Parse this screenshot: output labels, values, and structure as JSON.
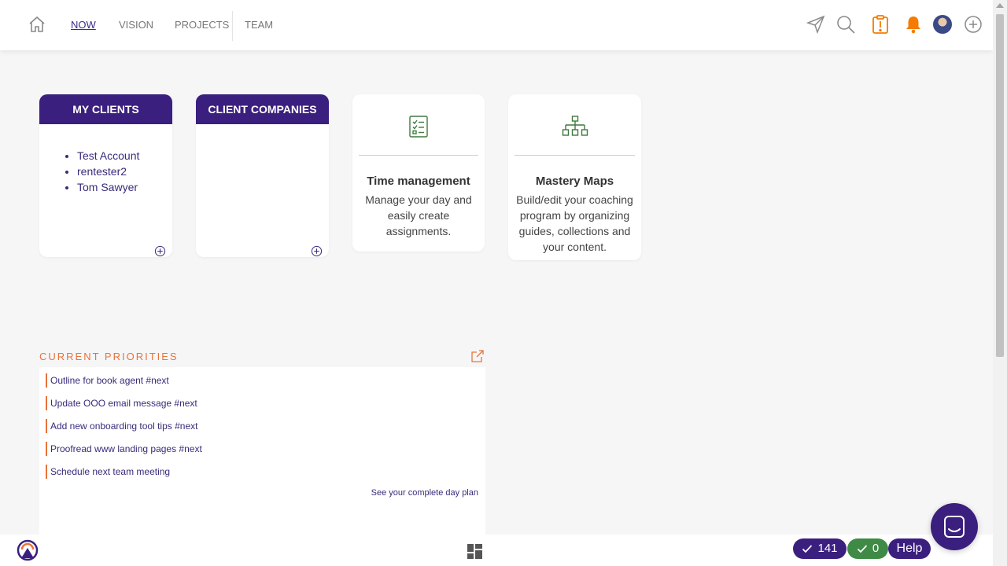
{
  "nav": {
    "tabs": [
      {
        "label": "NOW",
        "active": true
      },
      {
        "label": "VISION",
        "active": false
      },
      {
        "label": "PROJECTS",
        "active": false
      },
      {
        "label": "TEAM",
        "active": false
      }
    ],
    "icons": [
      "home-icon",
      "send-icon",
      "search-icon",
      "clipboard-alert-icon",
      "bell-icon",
      "avatar",
      "add-circle-icon"
    ]
  },
  "cards": {
    "my_clients": {
      "title": "MY CLIENTS",
      "items": [
        "Test Account",
        "rentester2",
        "Tom Sawyer"
      ]
    },
    "client_companies": {
      "title": "CLIENT COMPANIES"
    },
    "time_management": {
      "title": "Time management",
      "description": "Manage your day and easily create assignments."
    },
    "mastery_maps": {
      "title": "Mastery Maps",
      "description": "Build/edit your coaching program by organizing guides, collections and your content."
    }
  },
  "priorities": {
    "title": "CURRENT PRIORITIES",
    "items": [
      "Outline for book agent #next",
      "Update OOO email message #next",
      "Add new onboarding tool tips #next",
      "Proofread www landing pages #next",
      "Schedule next team meeting"
    ],
    "link": "See your complete day plan"
  },
  "footer": {
    "completed_count": "141",
    "green_count": "0",
    "help_label": "Help"
  },
  "colors": {
    "brand_purple": "#3b1f7e",
    "accent_orange": "#e8733a",
    "icon_green": "#3f7a3f",
    "pill_green": "#3f8a45",
    "bell_orange": "#f57c00"
  }
}
